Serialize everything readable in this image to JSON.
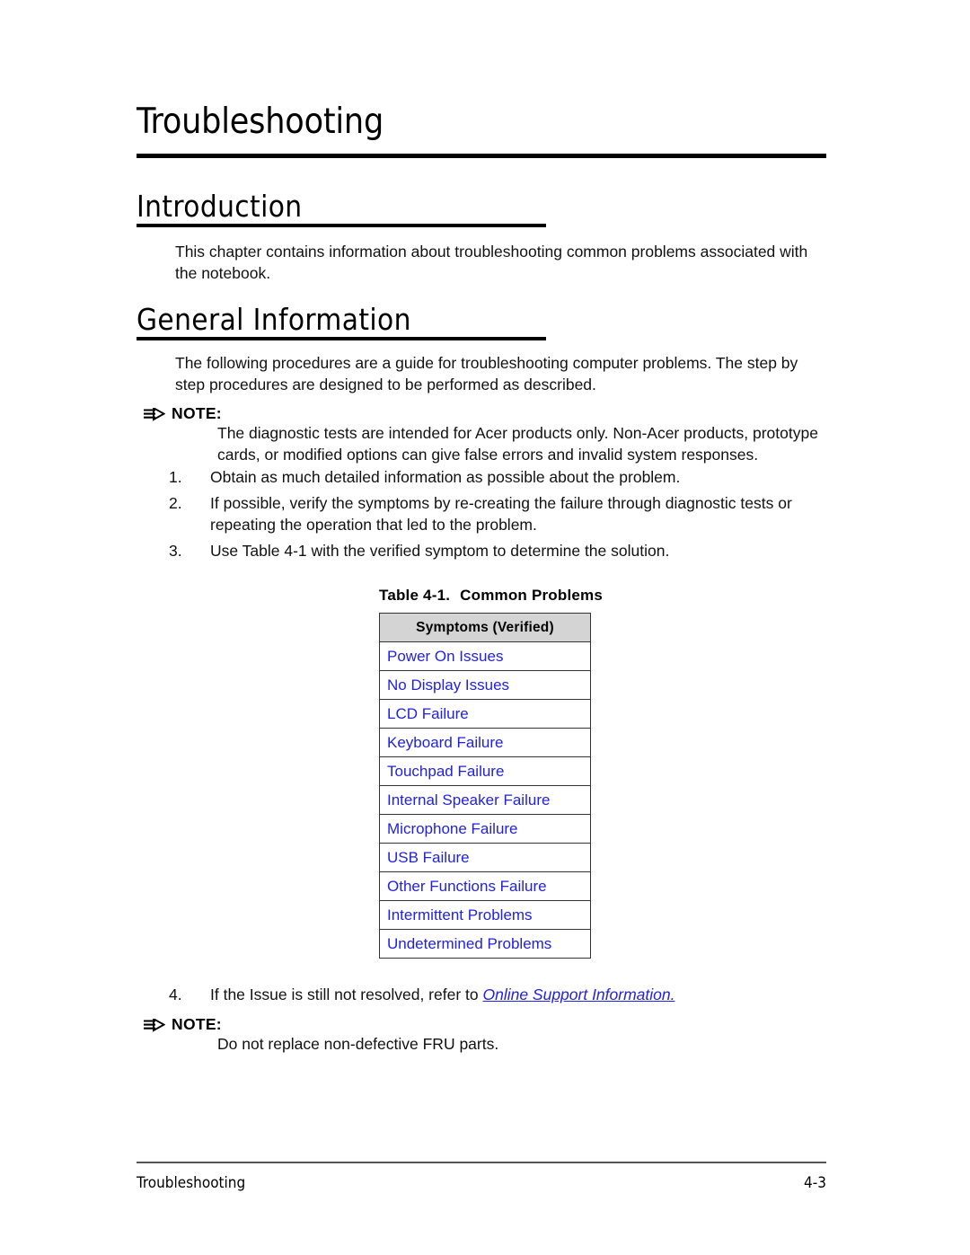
{
  "chapter": {
    "title": "Troubleshooting"
  },
  "sections": {
    "introduction": {
      "heading": "Introduction",
      "paragraph": "This chapter contains information about troubleshooting common problems associated with the notebook."
    },
    "general_information": {
      "heading": "General Information",
      "paragraph": "The following procedures are a guide for troubleshooting computer problems. The step by step procedures are designed to be performed as described."
    }
  },
  "notes": [
    {
      "label": "NOTE:",
      "icon": "triple-line-arrow-icon",
      "body": "The diagnostic tests are intended for Acer products only. Non-Acer products, prototype cards, or modified options can give false errors and invalid system responses."
    },
    {
      "label": "NOTE:",
      "icon": "triple-line-arrow-icon",
      "body": "Do not replace non-defective FRU parts."
    }
  ],
  "procedure_steps": [
    {
      "number": "1.",
      "text": "Obtain as much detailed information as possible about the problem."
    },
    {
      "number": "2.",
      "text": "If possible, verify the symptoms by re-creating the failure through diagnostic tests or repeating the operation that led to the problem."
    },
    {
      "number": "3.",
      "text": "Use Table 4-1 with the verified symptom to determine the solution."
    }
  ],
  "step_four": {
    "number": "4.",
    "text_before": "If the Issue is still not resolved, refer to ",
    "link_text": "Online Support Information."
  },
  "table": {
    "caption_number": "Table 4-1.",
    "caption_title": "Common Problems",
    "header": "Symptoms (Verified)",
    "rows": [
      "Power On Issues",
      "No Display Issues",
      "LCD Failure",
      "Keyboard Failure",
      "Touchpad Failure",
      "Internal Speaker Failure",
      "Microphone Failure",
      "USB Failure",
      "Other Functions Failure",
      "Intermittent Problems",
      "Undetermined Problems"
    ]
  },
  "footer": {
    "left": "Troubleshooting",
    "page_number": "4-3"
  },
  "colors": {
    "link": "#2222dd",
    "table_header_bg": "#d4d4d4",
    "rule": "#000000"
  }
}
